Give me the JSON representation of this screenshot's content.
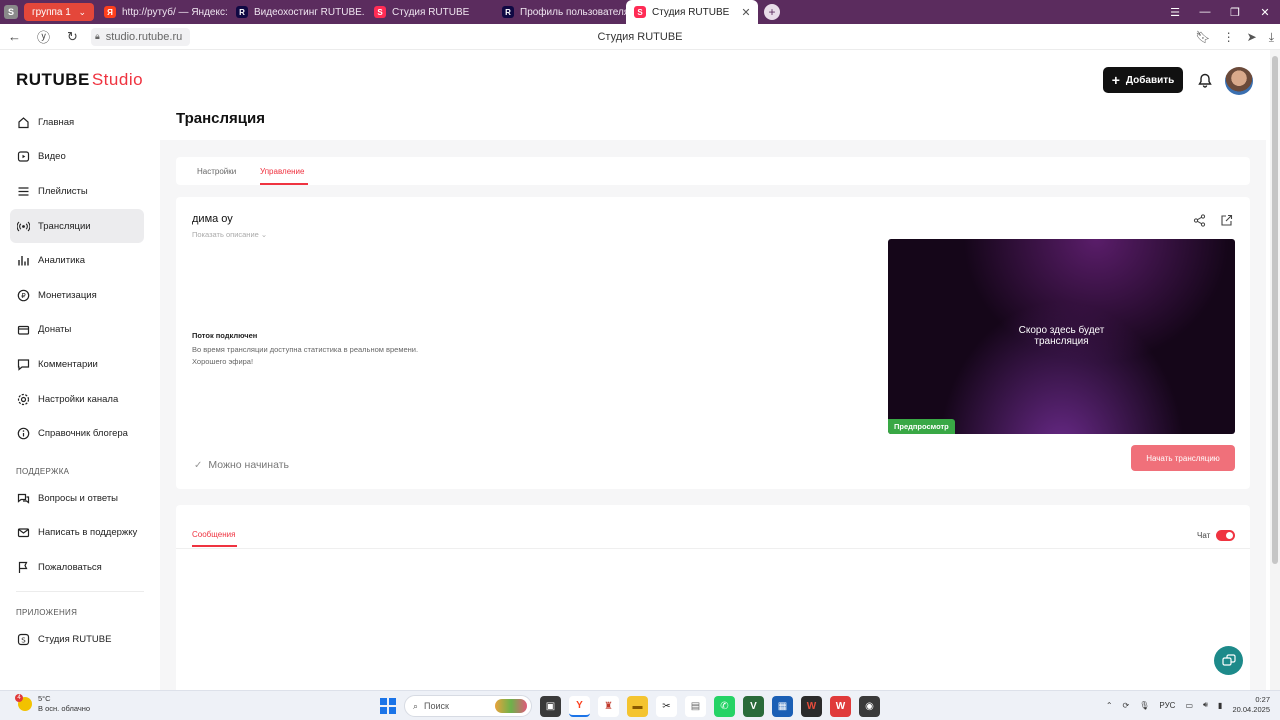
{
  "browser": {
    "tabs": [
      {
        "label": "группа 1",
        "kind": "group"
      },
      {
        "label": "http://рутуб/ — Яндекс:",
        "icon": "ya"
      },
      {
        "label": "Видеохостинг RUTUBE. С",
        "icon": "rr"
      },
      {
        "label": "Студия RUTUBE",
        "icon": "rt"
      },
      {
        "label": "Профиль пользователя",
        "icon": "rr"
      },
      {
        "label": "Студия RUTUBE",
        "icon": "rt",
        "active": true
      }
    ],
    "url": "studio.rutube.ru",
    "page_title": "Студия RUTUBE"
  },
  "header": {
    "logo_main": "RUTUBE",
    "logo_sub": "Studio",
    "add_label": "Добавить"
  },
  "sidebar": {
    "items": [
      {
        "label": "Главная",
        "icon": "home-icon"
      },
      {
        "label": "Видео",
        "icon": "video-icon"
      },
      {
        "label": "Плейлисты",
        "icon": "playlist-icon"
      },
      {
        "label": "Трансляции",
        "icon": "broadcast-icon",
        "active": true
      },
      {
        "label": "Аналитика",
        "icon": "analytics-icon"
      },
      {
        "label": "Монетизация",
        "icon": "monetization-icon"
      },
      {
        "label": "Донаты",
        "icon": "donate-icon"
      },
      {
        "label": "Комментарии",
        "icon": "comments-icon"
      },
      {
        "label": "Настройки канала",
        "icon": "settings-icon"
      },
      {
        "label": "Справочник блогера",
        "icon": "help-icon"
      }
    ],
    "support_title": "ПОДДЕРЖКА",
    "support_items": [
      {
        "label": "Вопросы и ответы",
        "icon": "faq-icon"
      },
      {
        "label": "Написать в поддержку",
        "icon": "mail-icon"
      },
      {
        "label": "Пожаловаться",
        "icon": "flag-icon"
      }
    ],
    "apps_title": "ПРИЛОЖЕНИЯ",
    "apps_items": [
      {
        "label": "Студия RUTUBE",
        "icon": "studio-app-icon"
      }
    ]
  },
  "main": {
    "title": "Трансляция",
    "tabs": [
      {
        "label": "Настройки"
      },
      {
        "label": "Управление",
        "active": true
      }
    ],
    "stream": {
      "name": "дима оу",
      "show_description": "Показать описание",
      "status_title": "Поток подключен",
      "status_line1": "Во время трансляции доступна статистика в реальном времени.",
      "status_line2": "Хорошего эфира!",
      "ready_label": "Можно начинать",
      "preview_line1": "Скоро здесь будет",
      "preview_line2": "трансляция",
      "preview_badge": "Предпросмотр",
      "start_button": "Начать трансляцию"
    },
    "messages": {
      "tab_label": "Сообщения",
      "chat_label": "Чат",
      "chat_enabled": true
    }
  },
  "taskbar": {
    "weather_temp": "5°C",
    "weather_desc": "В осн. облачно",
    "weather_badge": "4",
    "search_placeholder": "Поиск",
    "lang": "РУС",
    "time": "0:27",
    "date": "20.04.2025"
  },
  "colors": {
    "accent": "#ef3340",
    "browser_frame": "#5b2c5e",
    "preview_badge": "#39a845",
    "start_button": "#f0707a"
  }
}
